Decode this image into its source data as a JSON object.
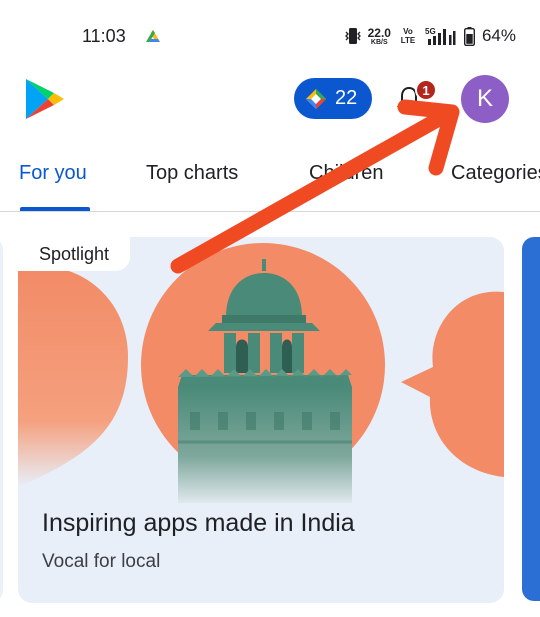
{
  "status_bar": {
    "time": "11:03",
    "net_speed_value": "22.0",
    "net_speed_unit": "KB/S",
    "volte_label": "Vo LTE",
    "network_type": "5G",
    "battery_percent": "64%"
  },
  "header": {
    "logo_icon": "google-play-logo",
    "points_value": "22",
    "points_icon": "play-points-diamond",
    "notification_count": "1",
    "avatar_initial": "K",
    "colors": {
      "points_chip": "#0b57d0",
      "avatar": "#8e5ec7",
      "badge": "#b3261e"
    }
  },
  "tabs": [
    {
      "label": "For you",
      "active": true
    },
    {
      "label": "Top charts",
      "active": false
    },
    {
      "label": "Children",
      "active": false
    },
    {
      "label": "Categories",
      "active": false
    }
  ],
  "featured_card": {
    "chip": "Spotlight",
    "title": "Inspiring apps made in India",
    "subtitle": "Vocal for local",
    "colors": {
      "background": "#e8eff9",
      "accent_shape": "#f28b66",
      "monument": "#4f8f7c"
    }
  },
  "annotation": {
    "type": "arrow",
    "color": "#f04a23",
    "points_to": "avatar"
  }
}
